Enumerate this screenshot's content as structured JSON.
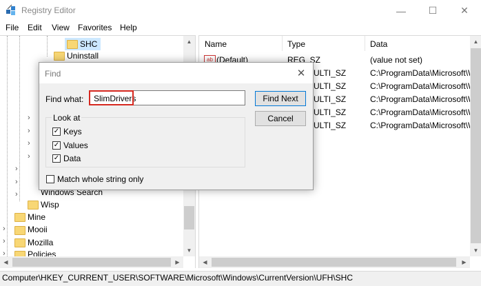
{
  "window": {
    "title": "Registry Editor",
    "minimize": "—",
    "maximize": "☐",
    "close": "✕"
  },
  "menu": [
    "File",
    "Edit",
    "View",
    "Favorites",
    "Help"
  ],
  "tree": [
    {
      "label": "SHC",
      "selected": true
    },
    {
      "label": "Uninstall"
    },
    {
      "label": "Windows Search"
    },
    {
      "label": "Wisp"
    },
    {
      "label": "Mine"
    },
    {
      "label": "Mooii"
    },
    {
      "label": "Mozilla"
    },
    {
      "label": "Policies"
    }
  ],
  "list": {
    "columns": [
      "Name",
      "Type",
      "Data"
    ],
    "rows": [
      {
        "name": "(Default)",
        "type": "REG_SZ",
        "data": "(value not set)"
      },
      {
        "name": "",
        "type": "ULTI_SZ",
        "data": "C:\\ProgramData\\Microsoft\\W"
      },
      {
        "name": "",
        "type": "ULTI_SZ",
        "data": "C:\\ProgramData\\Microsoft\\W"
      },
      {
        "name": "",
        "type": "ULTI_SZ",
        "data": "C:\\ProgramData\\Microsoft\\W"
      },
      {
        "name": "",
        "type": "ULTI_SZ",
        "data": "C:\\ProgramData\\Microsoft\\W"
      },
      {
        "name": "",
        "type": "ULTI_SZ",
        "data": "C:\\ProgramData\\Microsoft\\W"
      }
    ]
  },
  "find_dialog": {
    "title": "Find",
    "find_what_label": "Find what:",
    "find_what_value": "SlimDrivers",
    "find_next": "Find Next",
    "cancel": "Cancel",
    "look_at_label": "Look at",
    "keys": "Keys",
    "values": "Values",
    "data": "Data",
    "match_whole": "Match whole string only",
    "keys_checked": true,
    "values_checked": true,
    "data_checked": true,
    "match_whole_checked": false
  },
  "status": "Computer\\HKEY_CURRENT_USER\\SOFTWARE\\Microsoft\\Windows\\CurrentVersion\\UFH\\SHC",
  "colors": {
    "highlight": "#d6281f",
    "folder": "#f8d775",
    "accent": "#0078d7",
    "selected": "#cce8ff"
  }
}
